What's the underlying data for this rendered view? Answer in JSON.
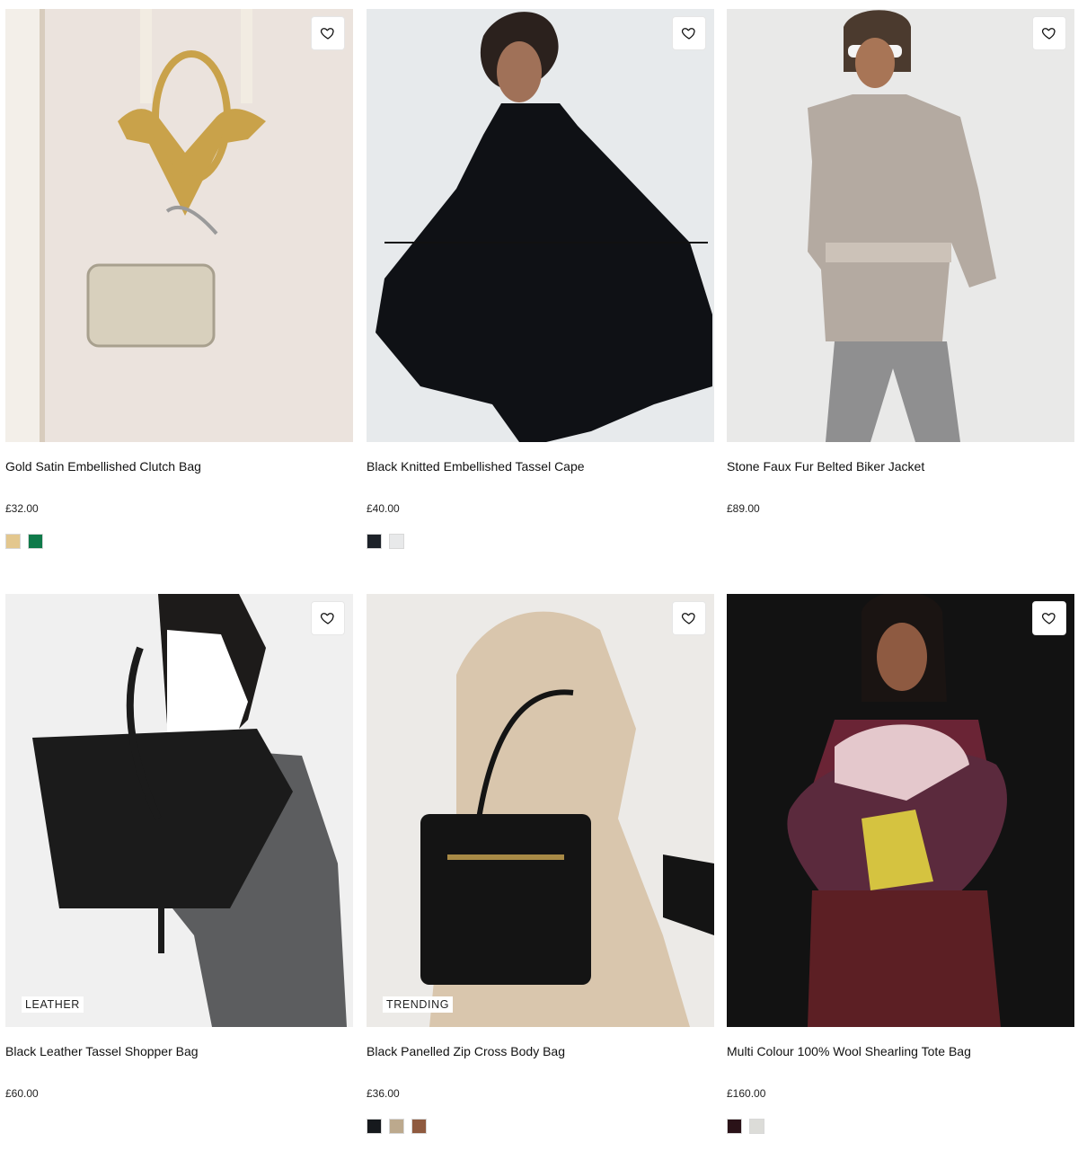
{
  "products": [
    {
      "title": "Gold Satin Embellished Clutch Bag",
      "price": "£32.00",
      "badge": "",
      "swatches": [
        "#e3c78e",
        "#0f7a4a"
      ]
    },
    {
      "title": "Black Knitted Embellished Tassel Cape",
      "price": "£40.00",
      "badge": "",
      "swatches": [
        "#1d2229",
        "#e8e9ea"
      ]
    },
    {
      "title": "Stone Faux Fur Belted Biker Jacket",
      "price": "£89.00",
      "badge": "",
      "swatches": []
    },
    {
      "title": "Black Leather Tassel Shopper Bag",
      "price": "£60.00",
      "badge": "LEATHER",
      "swatches": []
    },
    {
      "title": "Black Panelled Zip Cross Body Bag",
      "price": "£36.00",
      "badge": "TRENDING",
      "swatches": [
        "#16191d",
        "#bca98d",
        "#8f5a3f"
      ]
    },
    {
      "title": "Multi Colour 100% Wool Shearling Tote Bag",
      "price": "£160.00",
      "badge": "",
      "swatches": [
        "#2a1218",
        "#dcdcd8"
      ]
    }
  ],
  "icons": {
    "wishlist": "heart-outline-icon"
  }
}
